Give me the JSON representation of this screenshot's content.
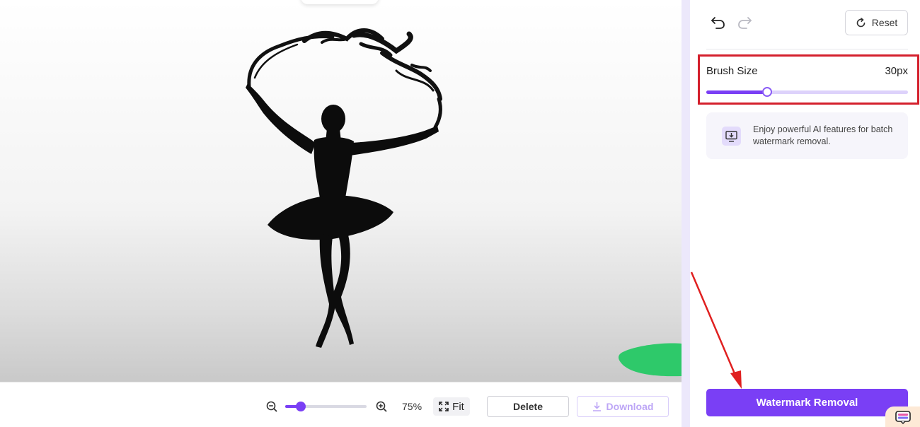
{
  "canvas": {
    "image": "ballerina-silhouette-photo",
    "brush_mark_color": "#2ec96a"
  },
  "toolbar": {
    "zoom_out_icon": "zoom-out-icon",
    "zoom_in_icon": "zoom-in-icon",
    "zoom_percent": "75%",
    "zoom_level_fraction": 0.19,
    "fit_label": "Fit",
    "delete_label": "Delete",
    "download_label": "Download"
  },
  "panel": {
    "undo_icon": "undo-icon",
    "redo_icon": "redo-icon",
    "reset_label": "Reset",
    "brush_size_label": "Brush Size",
    "brush_size_value": "30px",
    "brush_slider_fraction": 0.3,
    "promo_text": "Enjoy powerful AI features for batch watermark removal.",
    "watermark_removal_label": "Watermark Removal"
  },
  "colors": {
    "accent": "#7a3ff5",
    "highlight_box": "#d4202c",
    "annotation_arrow": "#e02020"
  }
}
